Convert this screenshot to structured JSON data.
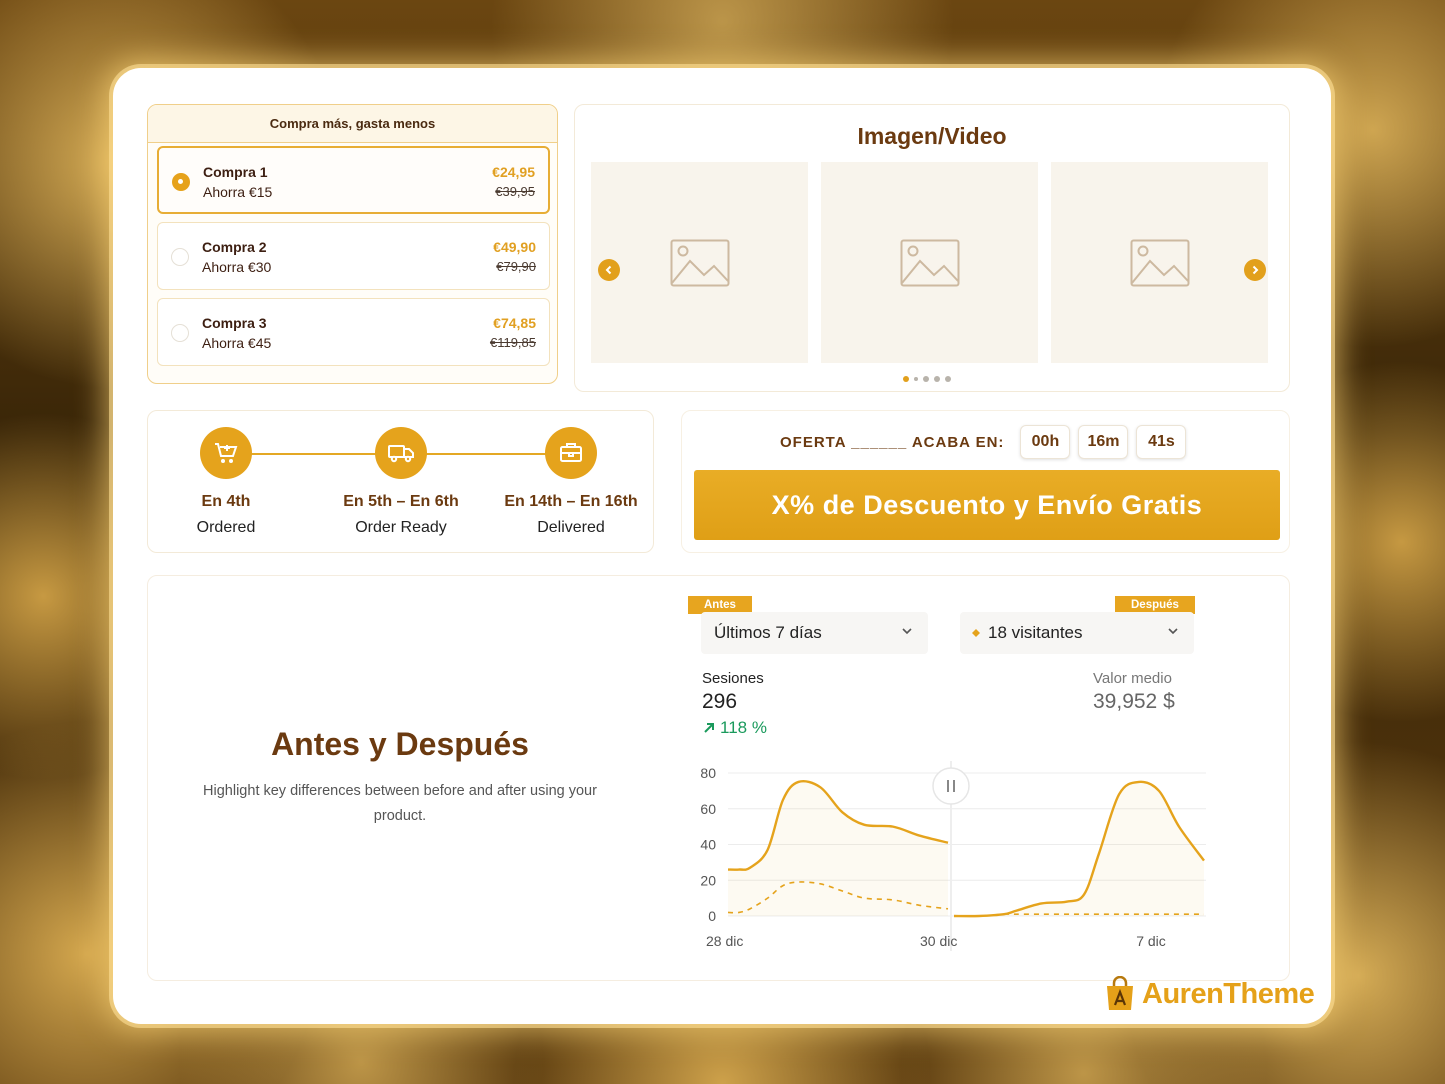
{
  "bundle": {
    "title": "Compra más, gasta menos",
    "options": [
      {
        "title": "Compra 1",
        "save": "Ahorra €15",
        "price": "€24,95",
        "old_price": "€39,95",
        "selected": true
      },
      {
        "title": "Compra 2",
        "save": "Ahorra €30",
        "price": "€49,90",
        "old_price": "€79,90",
        "selected": false
      },
      {
        "title": "Compra 3",
        "save": "Ahorra €45",
        "price": "€74,85",
        "old_price": "€119,85",
        "selected": false
      }
    ]
  },
  "media": {
    "title": "Imagen/Video",
    "slide_count": 4,
    "active_slide": 1
  },
  "timeline": {
    "steps": [
      {
        "date": "En 4th",
        "label": "Ordered",
        "icon": "cart-icon"
      },
      {
        "date": "En 5th – En 6th",
        "label": "Order Ready",
        "icon": "truck-icon"
      },
      {
        "date": "En 14th – En 16th",
        "label": "Delivered",
        "icon": "package-icon"
      }
    ]
  },
  "offer": {
    "text": "OFERTA ______ ACABA EN:",
    "hours": "00h",
    "minutes": "16m",
    "seconds": "41s",
    "button": "X% de Descuento y Envío Gratis"
  },
  "before_after": {
    "title": "Antes y Después",
    "description": "Highlight key differences between before and after using your product.",
    "before_tag": "Antes",
    "after_tag": "Después",
    "before_select": "Últimos 7 días",
    "after_select": "18 visitantes",
    "sessions_label": "Sesiones",
    "sessions_value": "296",
    "sessions_trend": "118 %",
    "avg_label": "Valor medio",
    "avg_value": "39,952 $"
  },
  "chart_data": {
    "type": "line",
    "y_ticks": [
      "80",
      "60",
      "40",
      "20",
      "0"
    ],
    "ylim": [
      0,
      80
    ],
    "x_labels": [
      "28 dic",
      "30 dic",
      "7 dic"
    ],
    "before": {
      "x": [
        0,
        0.05,
        0.1,
        0.18,
        0.25,
        0.32,
        0.42,
        0.52,
        0.62,
        0.75,
        0.87,
        1.0
      ],
      "primary": [
        26,
        26,
        27,
        37,
        65,
        75,
        72,
        58,
        51,
        50,
        45,
        41
      ],
      "secondary": [
        2,
        2,
        4,
        10,
        17,
        19,
        18,
        14,
        10,
        9,
        6,
        4
      ]
    },
    "after": {
      "x": [
        0,
        0.1,
        0.2,
        0.25,
        0.35,
        0.45,
        0.52,
        0.58,
        0.66,
        0.74,
        0.82,
        0.9,
        1.0
      ],
      "primary": [
        0,
        0,
        1,
        3,
        7,
        8,
        12,
        35,
        68,
        75,
        70,
        50,
        31
      ],
      "secondary": [
        0,
        0,
        1,
        1,
        1,
        1,
        1,
        1,
        1,
        1,
        1,
        1,
        1
      ]
    }
  },
  "brand": {
    "name": "AurenTheme"
  },
  "colors": {
    "accent": "#E5A31C",
    "brown": "#6B3A10",
    "green": "#1A9A5C"
  }
}
